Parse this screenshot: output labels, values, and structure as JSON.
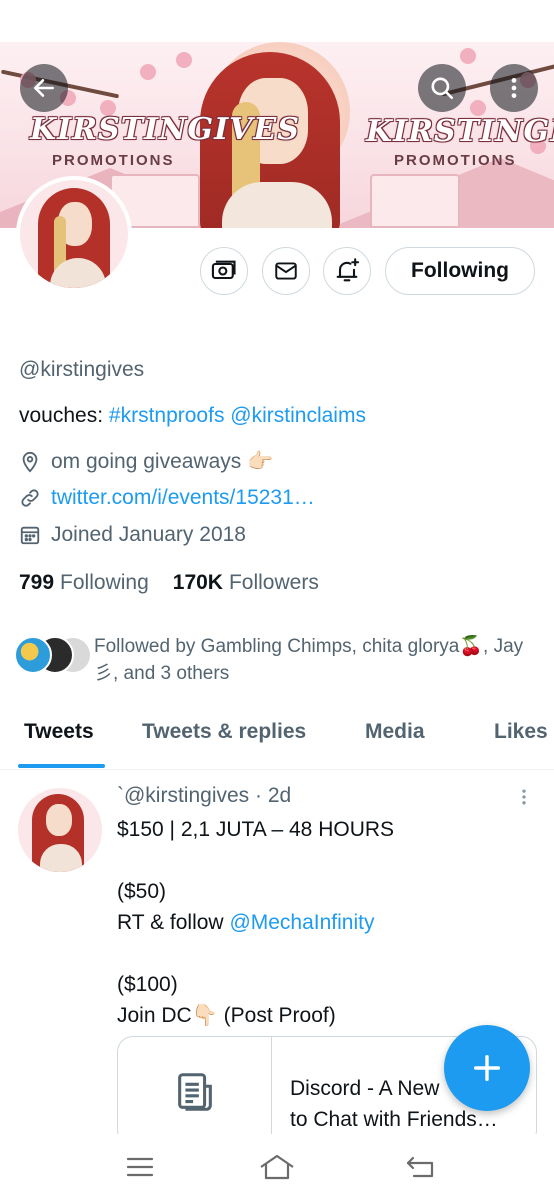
{
  "profile": {
    "handle": "@kirstingives",
    "bio_prefix": "vouches: ",
    "bio_tag": "#krstnproofs",
    "bio_mention": "@kirstinclaims",
    "location": "om going giveaways 👉🏻",
    "url": "twitter.com/i/events/15231…",
    "joined": "Joined January 2018",
    "following_count": "799",
    "following_label": "Following",
    "followers_count": "170K",
    "followers_label": "Followers",
    "followed_by": "Followed by Gambling Chimps, chita glorya🍒, Jay 彡, and 3 others",
    "follow_button_label": "Following"
  },
  "banner": {
    "brand_left": "KIRSTINGIVES",
    "brand_left_sub": "PROMOTIONS",
    "brand_right": "KIRSTINGIVES",
    "brand_right_sub": "PROMOTIONS"
  },
  "tabs": [
    {
      "label": "Tweets"
    },
    {
      "label": "Tweets & replies"
    },
    {
      "label": "Media"
    },
    {
      "label": "Likes"
    }
  ],
  "tweet": {
    "author_line": "`@kirstingives · 2d",
    "line1": "$150 | 2,1 JUTA – 48 HOURS",
    "line2": "($50)",
    "line3_prefix": "RT & follow ",
    "line3_mention": "@MechaInfinity",
    "line4": "($100)",
    "line5": "Join DC👇🏻 (Post Proof)",
    "card_title_line1": "Discord - A New",
    "card_title_line2": "to Chat with Friends…"
  },
  "icons": {
    "back": "arrow-left-icon",
    "search": "search-icon",
    "more": "more-vertical-icon",
    "tip": "money-icon",
    "message": "mail-icon",
    "notify": "bell-plus-icon",
    "location": "location-pin-icon",
    "link": "link-icon",
    "calendar": "calendar-icon",
    "compose": "plus-icon",
    "nav_menu": "menu-icon",
    "nav_home": "home-icon",
    "nav_back": "back-icon"
  },
  "colors": {
    "accent": "#1d9bf0",
    "text_primary": "#0f1419",
    "text_secondary": "#536471"
  }
}
